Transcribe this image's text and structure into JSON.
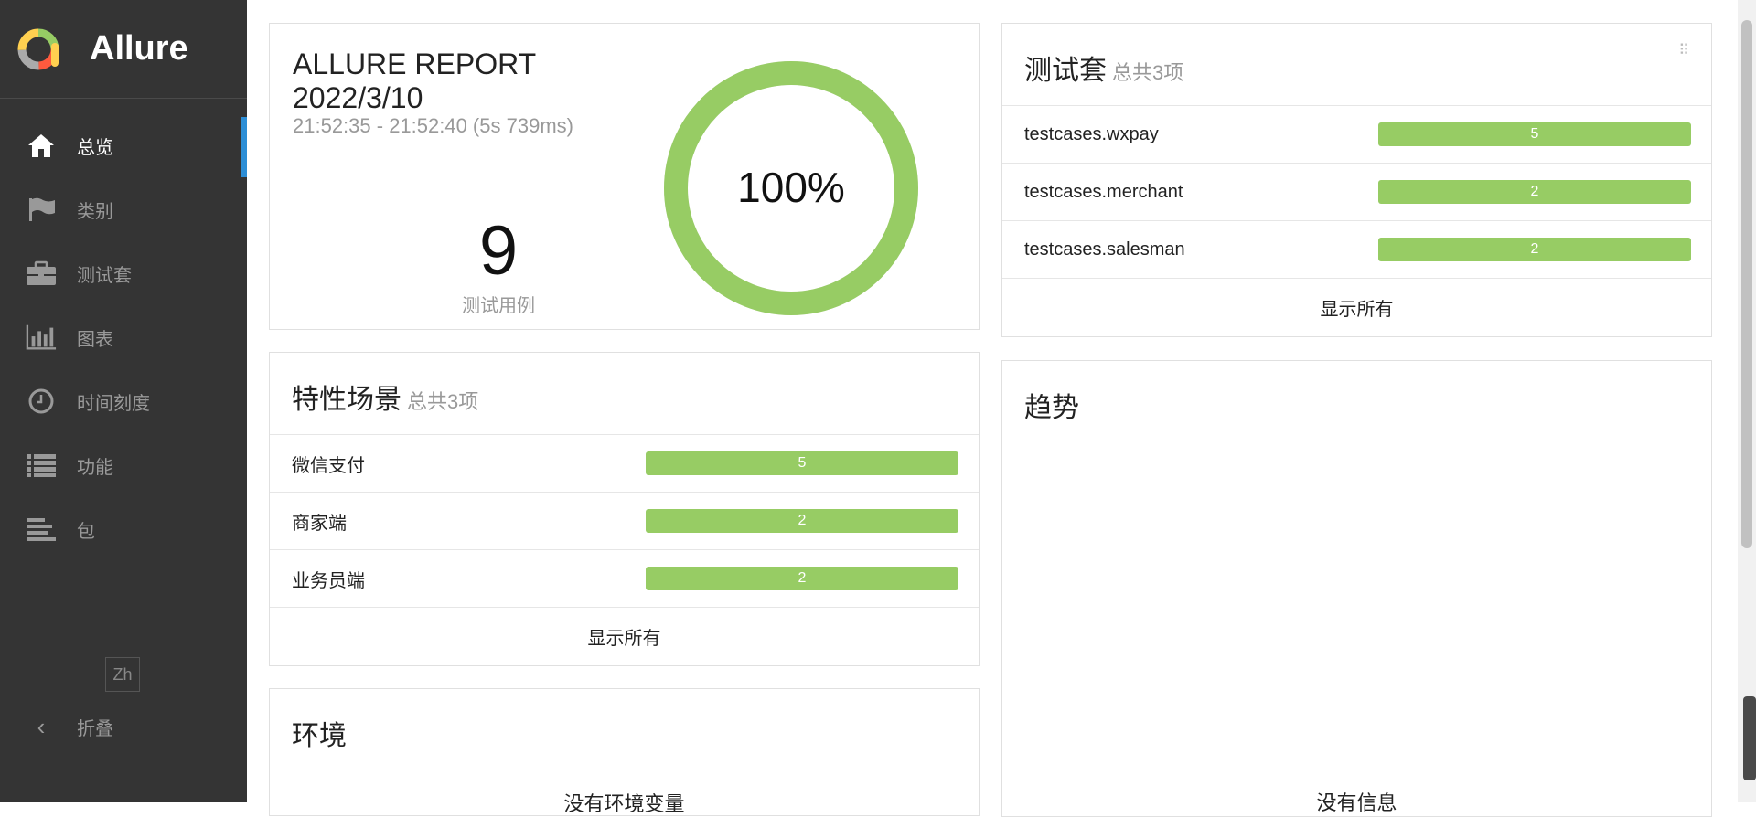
{
  "brand": {
    "name": "Allure"
  },
  "sidebar": {
    "items": [
      {
        "label": "总览",
        "icon": "home-icon",
        "active": true
      },
      {
        "label": "类别",
        "icon": "flag-icon",
        "active": false
      },
      {
        "label": "测试套",
        "icon": "briefcase-icon",
        "active": false
      },
      {
        "label": "图表",
        "icon": "bar-chart-icon",
        "active": false
      },
      {
        "label": "时间刻度",
        "icon": "clock-icon",
        "active": false
      },
      {
        "label": "功能",
        "icon": "list-icon",
        "active": false
      },
      {
        "label": "包",
        "icon": "align-left-icon",
        "active": false
      }
    ],
    "lang": "Zh",
    "collapse_label": "折叠"
  },
  "summary": {
    "title_line1": "ALLURE REPORT",
    "title_line2": "2022/3/10",
    "time_range": "21:52:35 - 21:52:40 (5s 739ms)",
    "case_count": "9",
    "case_label": "测试用例",
    "pass_rate": "100%",
    "pass_fraction": 1.0,
    "accent_color": "#97cc64"
  },
  "features": {
    "title": "特性场景",
    "subtitle": "总共3项",
    "rows": [
      {
        "label": "微信支付",
        "value": "5"
      },
      {
        "label": "商家端",
        "value": "2"
      },
      {
        "label": "业务员端",
        "value": "2"
      }
    ],
    "show_all": "显示所有"
  },
  "suites": {
    "title": "测试套",
    "subtitle": "总共3项",
    "rows": [
      {
        "label": "testcases.wxpay",
        "value": "5"
      },
      {
        "label": "testcases.merchant",
        "value": "2"
      },
      {
        "label": "testcases.salesman",
        "value": "2"
      }
    ],
    "show_all": "显示所有"
  },
  "trend": {
    "title": "趋势",
    "empty": "没有信息"
  },
  "environment": {
    "title": "环境",
    "empty": "没有环境变量"
  }
}
